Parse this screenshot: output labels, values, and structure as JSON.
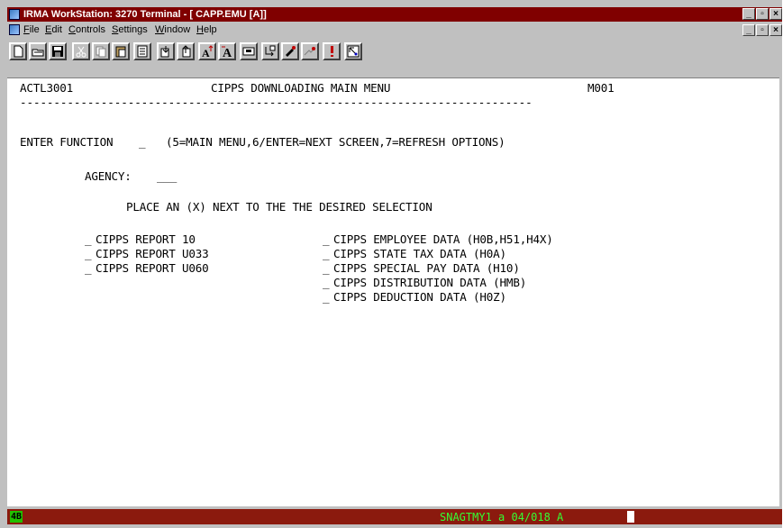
{
  "window": {
    "title": "IRMA WorkStation: 3270 Terminal  - [ CAPP.EMU [A]]",
    "buttons": [
      "_",
      "▫",
      "×"
    ]
  },
  "menubar": {
    "items": [
      {
        "accel": "F",
        "rest": "ile"
      },
      {
        "accel": "E",
        "rest": "dit"
      },
      {
        "accel": "C",
        "rest": "ontrols"
      },
      {
        "accel": "S",
        "rest": "ettings"
      },
      {
        "accel": "W",
        "rest": "indow"
      },
      {
        "accel": "H",
        "rest": "elp"
      }
    ]
  },
  "toolbar": {
    "icons": [
      "new-document-icon",
      "open-folder-icon",
      "save-icon",
      "cut-icon",
      "copy-icon",
      "paste-icon",
      "print-icon",
      "receive-file-icon",
      "send-file-icon",
      "font-up-icon",
      "font-down-icon",
      "screen-icon",
      "transfer-icon",
      "macro-icon",
      "keyboard-icon",
      "alert-icon",
      "cursor-icon"
    ]
  },
  "terminal": {
    "screen_id": "ACTL3001",
    "screen_title": "CIPPS DOWNLOADING MAIN MENU",
    "map_id": "M001",
    "separator": "----------------------------------------------------------------------------",
    "function_label": "ENTER FUNCTION",
    "function_field": "_",
    "function_hint": "(5=MAIN MENU,6/ENTER=NEXT SCREEN,7=REFRESH OPTIONS)",
    "agency_label": "AGENCY:",
    "agency_field": "___",
    "instruction": "PLACE AN (X) NEXT TO THE THE DESIRED SELECTION",
    "left_options": [
      {
        "marker": "_",
        "label": "CIPPS REPORT 10"
      },
      {
        "marker": "_",
        "label": "CIPPS REPORT U033"
      },
      {
        "marker": "_",
        "label": "CIPPS REPORT U060"
      }
    ],
    "right_options": [
      {
        "marker": "_",
        "label": "CIPPS EMPLOYEE DATA (H0B,H51,H4X)"
      },
      {
        "marker": "_",
        "label": "CIPPS STATE TAX DATA (H0A)"
      },
      {
        "marker": "_",
        "label": "CIPPS SPECIAL PAY DATA (H10)"
      },
      {
        "marker": "_",
        "label": "CIPPS DISTRIBUTION DATA (HMB)"
      },
      {
        "marker": "_",
        "label": "CIPPS DEDUCTION DATA (H0Z)"
      }
    ]
  },
  "statusbar": {
    "indicator": "4B",
    "text": "SNAGTMY1 a 04/018 A"
  }
}
